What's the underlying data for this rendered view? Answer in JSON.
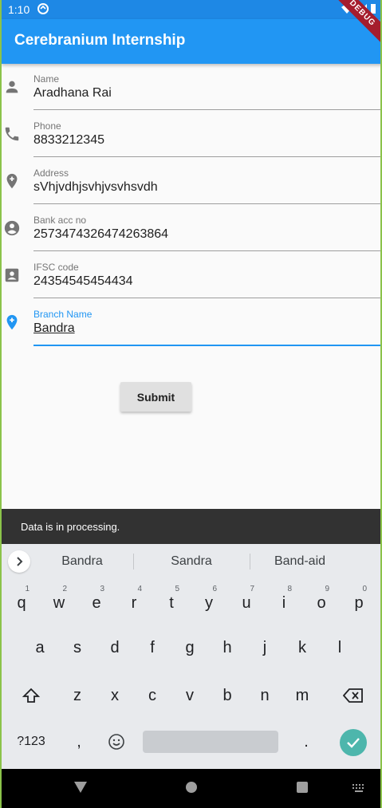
{
  "status_bar": {
    "time": "1:10",
    "debug_banner": "DEBUG"
  },
  "app_bar": {
    "title": "Cerebranium Internship"
  },
  "form": {
    "fields": [
      {
        "label": "Name",
        "value": "Aradhana Rai",
        "icon": "person-icon"
      },
      {
        "label": "Phone",
        "value": "8833212345",
        "icon": "phone-icon"
      },
      {
        "label": "Address",
        "value": "sVhjvdhjsvhjvsvhsvdh",
        "icon": "add-location-icon"
      },
      {
        "label": "Bank acc no",
        "value": "2573474326474263864",
        "icon": "account-circle-icon"
      },
      {
        "label": "IFSC code",
        "value": "24354545454434",
        "icon": "contact-card-icon"
      },
      {
        "label": "Branch Name",
        "value": "Bandra",
        "icon": "add-location-icon"
      }
    ],
    "submit_label": "Submit"
  },
  "snackbar": {
    "text": "Data is in processing."
  },
  "keyboard": {
    "suggestions": [
      "Bandra",
      "Sandra",
      "Band-aid"
    ],
    "row1": [
      "q",
      "w",
      "e",
      "r",
      "t",
      "y",
      "u",
      "i",
      "o",
      "p"
    ],
    "row1_hints": [
      "1",
      "2",
      "3",
      "4",
      "5",
      "6",
      "7",
      "8",
      "9",
      "0"
    ],
    "row2": [
      "a",
      "s",
      "d",
      "f",
      "g",
      "h",
      "j",
      "k",
      "l"
    ],
    "row3": [
      "z",
      "x",
      "c",
      "v",
      "b",
      "n",
      "m"
    ],
    "symbols_label": "?123",
    "comma": ",",
    "period": "."
  },
  "colors": {
    "primary": "#2196f3",
    "status_bar": "#1e88e5",
    "snackbar": "#323232",
    "enter_key": "#4db6ac"
  }
}
